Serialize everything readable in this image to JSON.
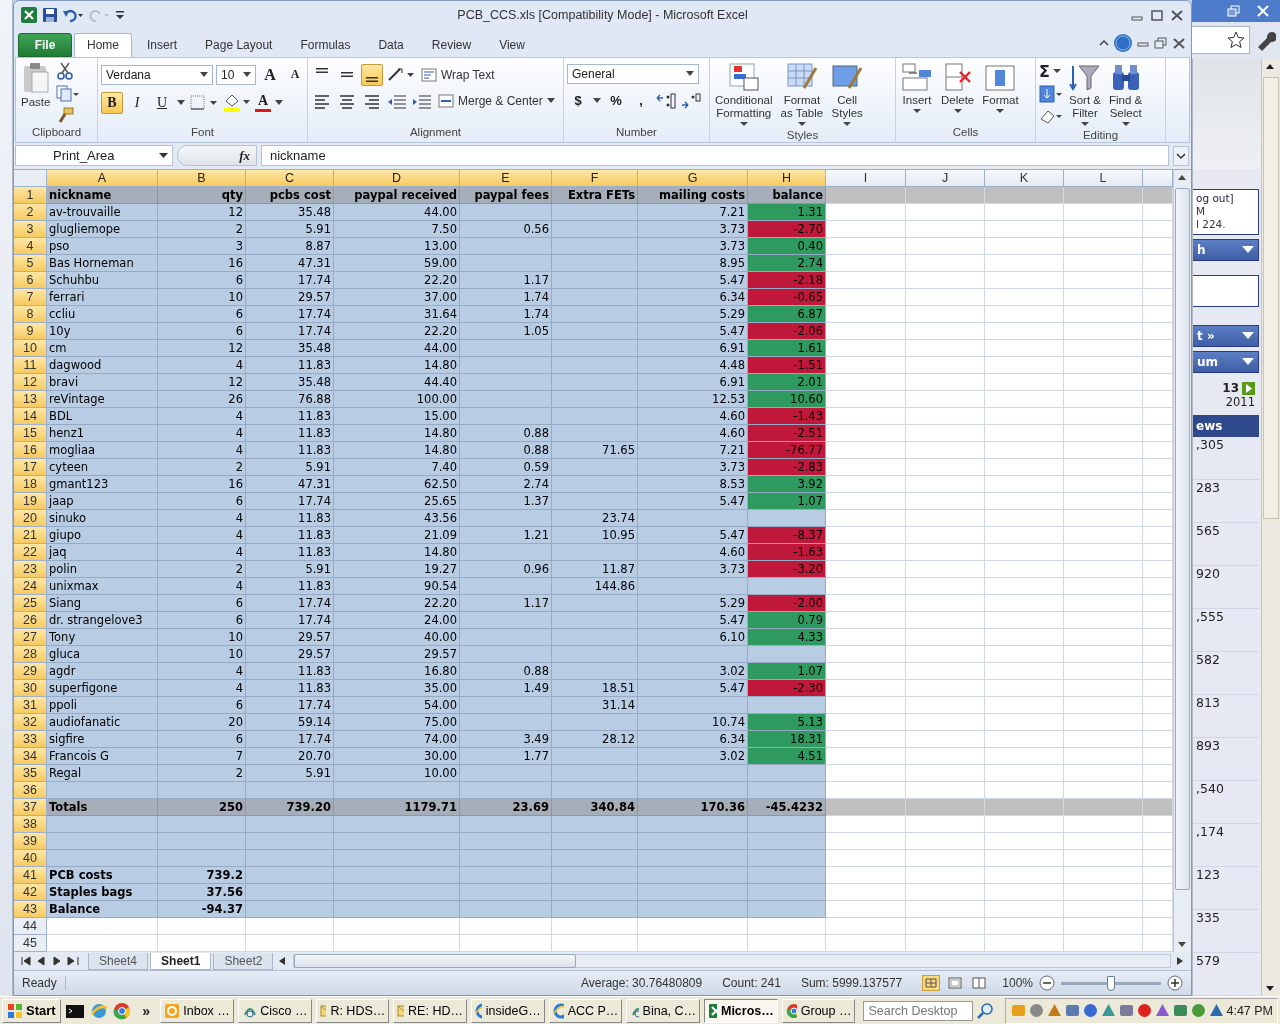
{
  "window": {
    "title": "PCB_CCS.xls  [Compatibility Mode]  -  Microsoft Excel"
  },
  "ribbon_tabs": [
    {
      "label": "File",
      "kind": "file",
      "selected": false
    },
    {
      "label": "Home",
      "kind": "tab",
      "selected": true
    },
    {
      "label": "Insert",
      "kind": "tab",
      "selected": false
    },
    {
      "label": "Page Layout",
      "kind": "tab",
      "selected": false
    },
    {
      "label": "Formulas",
      "kind": "tab",
      "selected": false
    },
    {
      "label": "Data",
      "kind": "tab",
      "selected": false
    },
    {
      "label": "Review",
      "kind": "tab",
      "selected": false
    },
    {
      "label": "View",
      "kind": "tab",
      "selected": false
    }
  ],
  "clipboard": {
    "paste": "Paste",
    "label": "Clipboard"
  },
  "font": {
    "family": "Verdana",
    "size": "10",
    "grow": "A",
    "shrink": "A",
    "bold": {
      "label": "B",
      "selected": true
    },
    "italic": {
      "label": "I",
      "selected": false
    },
    "underline": {
      "label": "U",
      "selected": false
    },
    "color_label": "A",
    "label": "Font"
  },
  "alignment": {
    "vertical": [
      {
        "selected": false
      },
      {
        "selected": false
      },
      {
        "selected": true
      }
    ],
    "wrap": "Wrap Text",
    "merge": "Merge & Center",
    "label": "Alignment"
  },
  "number": {
    "format": "General",
    "currency": "$",
    "percent": "%",
    "comma": ",",
    "label": "Number"
  },
  "styles": {
    "buttons": [
      {
        "lines": [
          "Conditional",
          "Formatting"
        ]
      },
      {
        "lines": [
          "Format",
          "as Table"
        ]
      },
      {
        "lines": [
          "Cell",
          "Styles"
        ]
      }
    ],
    "label": "Styles"
  },
  "cells_group": {
    "buttons": [
      "Insert",
      "Delete",
      "Format"
    ],
    "label": "Cells"
  },
  "editing": {
    "autosum": "Σ",
    "buttons": [
      {
        "lines": [
          "Sort &",
          "Filter"
        ]
      },
      {
        "lines": [
          "Find &",
          "Select"
        ]
      }
    ],
    "label": "Editing"
  },
  "formula_bar": {
    "name_box": "Print_Area",
    "fx": "fx",
    "value": "nickname"
  },
  "grid": {
    "columns": [
      {
        "letter": "A",
        "selected": true
      },
      {
        "letter": "B",
        "selected": true
      },
      {
        "letter": "C",
        "selected": true
      },
      {
        "letter": "D",
        "selected": true
      },
      {
        "letter": "E",
        "selected": true
      },
      {
        "letter": "F",
        "selected": true
      },
      {
        "letter": "G",
        "selected": true
      },
      {
        "letter": "H",
        "selected": true
      },
      {
        "letter": "I",
        "selected": false
      },
      {
        "letter": "J",
        "selected": false
      },
      {
        "letter": "K",
        "selected": false
      },
      {
        "letter": "L",
        "selected": false
      }
    ],
    "rows": [
      {
        "num": "1",
        "kind": "header",
        "selected": true,
        "cells": {
          "A": "nickname",
          "B": "qty",
          "C": "pcbs cost",
          "D": "paypal received",
          "E": "paypal fees",
          "F": "Extra FETs",
          "G": "mailing costs",
          "H": "balance"
        }
      },
      {
        "num": "2",
        "kind": "data",
        "selected": true,
        "color": "#2f9a5f",
        "cells": {
          "A": "av-trouvaille",
          "B": "12",
          "C": "35.48",
          "D": "44.00",
          "G": "7.21",
          "H": "1.31"
        }
      },
      {
        "num": "3",
        "kind": "data",
        "selected": true,
        "color": "#c0183a",
        "cells": {
          "A": "glugliemope",
          "B": "2",
          "C": "5.91",
          "D": "7.50",
          "E": "0.56",
          "G": "3.73",
          "H": "-2.70"
        }
      },
      {
        "num": "4",
        "kind": "data",
        "selected": true,
        "color": "#2f9a5f",
        "cells": {
          "A": "pso",
          "B": "3",
          "C": "8.87",
          "D": "13.00",
          "G": "3.73",
          "H": "0.40"
        }
      },
      {
        "num": "5",
        "kind": "data",
        "selected": true,
        "color": "#2f9a5f",
        "cells": {
          "A": "Bas Horneman",
          "B": "16",
          "C": "47.31",
          "D": "59.00",
          "G": "8.95",
          "H": "2.74"
        }
      },
      {
        "num": "6",
        "kind": "data",
        "selected": true,
        "color": "#c0183a",
        "cells": {
          "A": "Schuhbu",
          "B": "6",
          "C": "17.74",
          "D": "22.20",
          "E": "1.17",
          "G": "5.47",
          "H": "-2.18"
        }
      },
      {
        "num": "7",
        "kind": "data",
        "selected": true,
        "color": "#c0183a",
        "cells": {
          "A": "ferrari",
          "B": "10",
          "C": "29.57",
          "D": "37.00",
          "E": "1.74",
          "G": "6.34",
          "H": "-0.65"
        }
      },
      {
        "num": "8",
        "kind": "data",
        "selected": true,
        "color": "#2f9a5f",
        "cells": {
          "A": "ccliu",
          "B": "6",
          "C": "17.74",
          "D": "31.64",
          "E": "1.74",
          "G": "5.29",
          "H": "6.87"
        }
      },
      {
        "num": "9",
        "kind": "data",
        "selected": true,
        "color": "#c0183a",
        "cells": {
          "A": "10y",
          "B": "6",
          "C": "17.74",
          "D": "22.20",
          "E": "1.05",
          "G": "5.47",
          "H": "-2.06"
        }
      },
      {
        "num": "10",
        "kind": "data",
        "selected": true,
        "color": "#2f9a5f",
        "cells": {
          "A": "cm",
          "B": "12",
          "C": "35.48",
          "D": "44.00",
          "G": "6.91",
          "H": "1.61"
        }
      },
      {
        "num": "11",
        "kind": "data",
        "selected": true,
        "color": "#c0183a",
        "cells": {
          "A": "dagwood",
          "B": "4",
          "C": "11.83",
          "D": "14.80",
          "G": "4.48",
          "H": "-1.51"
        }
      },
      {
        "num": "12",
        "kind": "data",
        "selected": true,
        "color": "#2f9a5f",
        "cells": {
          "A": "bravi",
          "B": "12",
          "C": "35.48",
          "D": "44.40",
          "G": "6.91",
          "H": "2.01"
        }
      },
      {
        "num": "13",
        "kind": "data",
        "selected": true,
        "color": "#2f9a5f",
        "cells": {
          "A": "reVintage",
          "B": "26",
          "C": "76.88",
          "D": "100.00",
          "G": "12.53",
          "H": "10.60"
        }
      },
      {
        "num": "14",
        "kind": "data",
        "selected": true,
        "color": "#c0183a",
        "cells": {
          "A": "BDL",
          "B": "4",
          "C": "11.83",
          "D": "15.00",
          "G": "4.60",
          "H": "-1.43"
        }
      },
      {
        "num": "15",
        "kind": "data",
        "selected": true,
        "color": "#c0183a",
        "cells": {
          "A": "henz1",
          "B": "4",
          "C": "11.83",
          "D": "14.80",
          "E": "0.88",
          "G": "4.60",
          "H": "-2.51"
        }
      },
      {
        "num": "16",
        "kind": "data",
        "selected": true,
        "color": "#c0183a",
        "cells": {
          "A": "mogliaa",
          "B": "4",
          "C": "11.83",
          "D": "14.80",
          "E": "0.88",
          "F": "71.65",
          "G": "7.21",
          "H": "-76.77"
        }
      },
      {
        "num": "17",
        "kind": "data",
        "selected": true,
        "color": "#c0183a",
        "cells": {
          "A": "cyteen",
          "B": "2",
          "C": "5.91",
          "D": "7.40",
          "E": "0.59",
          "G": "3.73",
          "H": "-2.83"
        }
      },
      {
        "num": "18",
        "kind": "data",
        "selected": true,
        "color": "#2f9a5f",
        "cells": {
          "A": "gmant123",
          "B": "16",
          "C": "47.31",
          "D": "62.50",
          "E": "2.74",
          "G": "8.53",
          "H": "3.92"
        }
      },
      {
        "num": "19",
        "kind": "data",
        "selected": true,
        "color": "#2f9a5f",
        "cells": {
          "A": "jaap",
          "B": "6",
          "C": "17.74",
          "D": "25.65",
          "E": "1.37",
          "G": "5.47",
          "H": "1.07"
        }
      },
      {
        "num": "20",
        "kind": "data",
        "selected": true,
        "cells": {
          "A": "sinuko",
          "B": "4",
          "C": "11.83",
          "D": "43.56",
          "F": "23.74"
        }
      },
      {
        "num": "21",
        "kind": "data",
        "selected": true,
        "color": "#c0183a",
        "cells": {
          "A": "giupo",
          "B": "4",
          "C": "11.83",
          "D": "21.09",
          "E": "1.21",
          "F": "10.95",
          "G": "5.47",
          "H": "-8.37"
        }
      },
      {
        "num": "22",
        "kind": "data",
        "selected": true,
        "color": "#c0183a",
        "cells": {
          "A": "jaq",
          "B": "4",
          "C": "11.83",
          "D": "14.80",
          "G": "4.60",
          "H": "-1.63"
        }
      },
      {
        "num": "23",
        "kind": "data",
        "selected": true,
        "color": "#c0183a",
        "cells": {
          "A": "polin",
          "B": "2",
          "C": "5.91",
          "D": "19.27",
          "E": "0.96",
          "F": "11.87",
          "G": "3.73",
          "H": "-3.20"
        }
      },
      {
        "num": "24",
        "kind": "data",
        "selected": true,
        "cells": {
          "A": "unixmax",
          "B": "4",
          "C": "11.83",
          "D": "90.54",
          "F": "144.86"
        }
      },
      {
        "num": "25",
        "kind": "data",
        "selected": true,
        "color": "#c0183a",
        "cells": {
          "A": "Siang",
          "B": "6",
          "C": "17.74",
          "D": "22.20",
          "E": "1.17",
          "G": "5.29",
          "H": "-2.00"
        }
      },
      {
        "num": "26",
        "kind": "data",
        "selected": true,
        "color": "#2f9a5f",
        "cells": {
          "A": "dr. strangelove3",
          "B": "6",
          "C": "17.74",
          "D": "24.00",
          "G": "5.47",
          "H": "0.79"
        }
      },
      {
        "num": "27",
        "kind": "data",
        "selected": true,
        "color": "#2f9a5f",
        "cells": {
          "A": "Tony",
          "B": "10",
          "C": "29.57",
          "D": "40.00",
          "G": "6.10",
          "H": "4.33"
        }
      },
      {
        "num": "28",
        "kind": "data",
        "selected": true,
        "cells": {
          "A": "gluca",
          "B": "10",
          "C": "29.57",
          "D": "29.57"
        }
      },
      {
        "num": "29",
        "kind": "data",
        "selected": true,
        "color": "#2f9a5f",
        "cells": {
          "A": "agdr",
          "B": "4",
          "C": "11.83",
          "D": "16.80",
          "E": "0.88",
          "G": "3.02",
          "H": "1.07"
        }
      },
      {
        "num": "30",
        "kind": "data",
        "selected": true,
        "color": "#c0183a",
        "cells": {
          "A": "superfigone",
          "B": "4",
          "C": "11.83",
          "D": "35.00",
          "E": "1.49",
          "F": "18.51",
          "G": "5.47",
          "H": "-2.30"
        }
      },
      {
        "num": "31",
        "kind": "data",
        "selected": true,
        "cells": {
          "A": "ppoli",
          "B": "6",
          "C": "17.74",
          "D": "54.00",
          "F": "31.14"
        }
      },
      {
        "num": "32",
        "kind": "data",
        "selected": true,
        "color": "#2f9a5f",
        "cells": {
          "A": "audiofanatic",
          "B": "20",
          "C": "59.14",
          "D": "75.00",
          "G": "10.74",
          "H": "5.13"
        }
      },
      {
        "num": "33",
        "kind": "data",
        "selected": true,
        "color": "#2f9a5f",
        "cells": {
          "A": "sigfire",
          "B": "6",
          "C": "17.74",
          "D": "74.00",
          "E": "3.49",
          "F": "28.12",
          "G": "6.34",
          "H": "18.31"
        }
      },
      {
        "num": "34",
        "kind": "data",
        "selected": true,
        "color": "#2f9a5f",
        "cells": {
          "A": "Francois G",
          "B": "7",
          "C": "20.70",
          "D": "30.00",
          "E": "1.77",
          "G": "3.02",
          "H": "4.51"
        }
      },
      {
        "num": "35",
        "kind": "data",
        "selected": true,
        "cells": {
          "A": "Regal",
          "B": "2",
          "C": "5.91",
          "D": "10.00"
        }
      },
      {
        "num": "36",
        "kind": "data",
        "selected": true,
        "cells": {}
      },
      {
        "num": "37",
        "kind": "total",
        "selected": true,
        "cells": {
          "A": "Totals",
          "B": "250",
          "C": "739.20",
          "D": "1179.71",
          "E": "23.69",
          "F": "340.84",
          "G": "170.36",
          "H": "-45.4232"
        }
      },
      {
        "num": "38",
        "kind": "data",
        "selected": true,
        "cells": {}
      },
      {
        "num": "39",
        "kind": "data",
        "selected": true,
        "cells": {}
      },
      {
        "num": "40",
        "kind": "data",
        "selected": true,
        "cells": {}
      },
      {
        "num": "41",
        "kind": "summary",
        "selected": true,
        "cells": {
          "A": "PCB costs",
          "B": "739.2"
        }
      },
      {
        "num": "42",
        "kind": "summary",
        "selected": true,
        "cells": {
          "A": "Staples bags",
          "B": "37.56"
        }
      },
      {
        "num": "43",
        "kind": "summary",
        "selected": true,
        "cells": {
          "A": "Balance",
          "B": "-94.37"
        }
      },
      {
        "num": "44",
        "kind": "data",
        "selected": false,
        "cells": {}
      },
      {
        "num": "45",
        "kind": "data",
        "selected": false,
        "cells": {}
      }
    ]
  },
  "sheet_tabs": [
    {
      "label": "Sheet4",
      "selected": false
    },
    {
      "label": "Sheet1",
      "selected": true
    },
    {
      "label": "Sheet2",
      "selected": false
    }
  ],
  "status_bar": {
    "mode": "Ready",
    "average": "Average: 30.76480809",
    "count": "Count: 241",
    "sum": "Sum: 5999.137577",
    "zoom": "100%",
    "zoom_slider": {
      "level": 0.5
    }
  },
  "taskbar": {
    "start": "Start",
    "more": "»",
    "tasks": [
      {
        "label": "Inbox …",
        "kind": "mail-app",
        "selected": false
      },
      {
        "label": "Cisco …",
        "kind": "phone-app",
        "selected": false
      },
      {
        "label": "R: HDS…",
        "kind": "message",
        "selected": false
      },
      {
        "label": "RE: HD…",
        "kind": "message",
        "selected": false
      },
      {
        "label": "insideG…",
        "kind": "web",
        "selected": false
      },
      {
        "label": "ACC P…",
        "kind": "web",
        "selected": false
      },
      {
        "label": "Bina, C…",
        "kind": "phone-app",
        "selected": false
      },
      {
        "label": "Micros…",
        "kind": "sheet",
        "selected": true
      },
      {
        "label": "Group …",
        "kind": "browser",
        "selected": false
      }
    ],
    "search": {
      "placeholder": "Search Desktop"
    },
    "clock": "4:47 PM"
  },
  "background_window": {
    "header_lines": [
      "og out]",
      "M",
      "l 224."
    ],
    "menu_buttons": [
      "h",
      "t »",
      "um"
    ],
    "date_lines": [
      "13",
      "2011"
    ],
    "column_title": "ews",
    "values": [
      ",305",
      "283",
      "565",
      "920",
      ",555",
      "582",
      "813",
      "893",
      ",540",
      ",174",
      "123",
      "335",
      "579"
    ]
  }
}
